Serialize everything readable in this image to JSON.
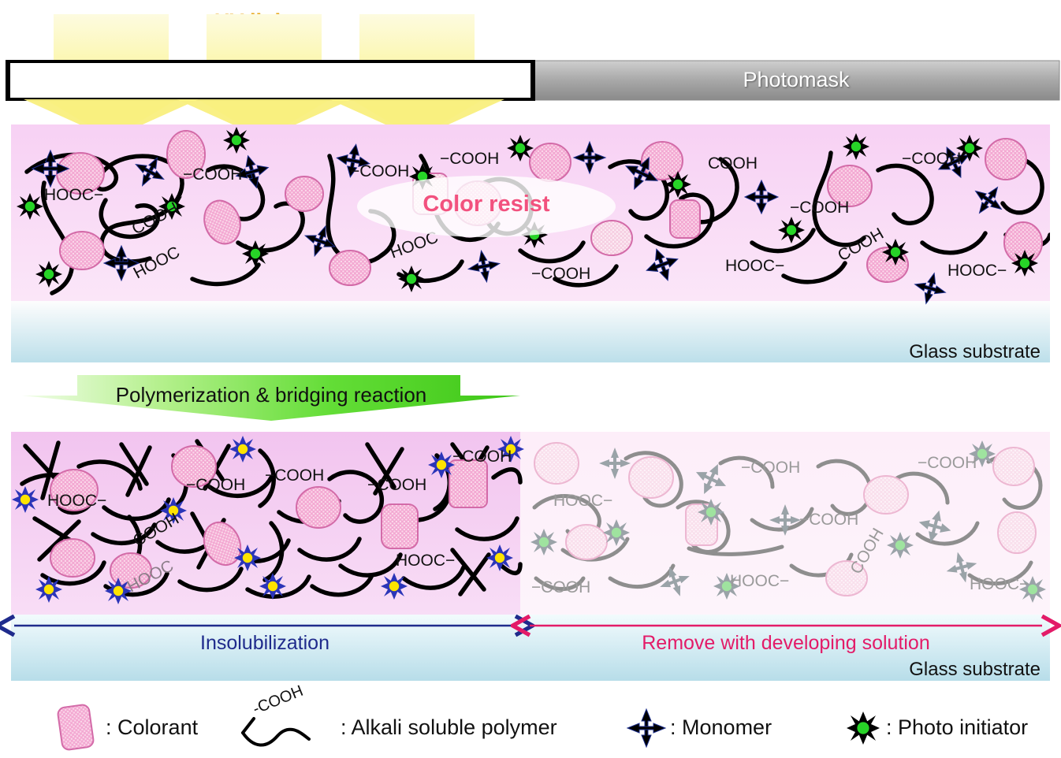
{
  "figure": {
    "type": "process-diagram",
    "subject": "Photolithographic patterning of color resist on glass substrate"
  },
  "uv": {
    "label": "UV light",
    "color": "#e8a81c",
    "beam_color": "#fbf7a8",
    "beam_count": 3
  },
  "photomask": {
    "label": "Photomask",
    "fill_start": "#c9c9c9",
    "fill_end": "#8d8d8d",
    "text_color": "#ffffff",
    "window_label": "",
    "window_border": "#000000"
  },
  "resist_top": {
    "label": "Color resist",
    "label_color": "#f2517e",
    "fill": "#f7d5f2"
  },
  "substrate": {
    "label": "Glass substrate",
    "fill_top": "#ffffff",
    "fill_bottom": "#bfe0ea",
    "text_color": "#1a1a1a"
  },
  "reaction_arrow": {
    "label": "Polymerization & bridging reaction",
    "fill_start": "#d9f7c0",
    "fill_end": "#49d котор",
    "color_a": "#dcf8c4",
    "color_b": "#53d42a",
    "text_color": "#111111"
  },
  "exposed_region": {
    "name": "cured-crosslinked-region",
    "fill": "#f3c8ef",
    "initiator_star": "#2b35b8",
    "initiator_core": "#ffe400",
    "chain_color": "#000000"
  },
  "unexposed_region": {
    "name": "washed-away-region",
    "fill": "#fdeef9",
    "initiator_star": "#9aa3a8",
    "initiator_core": "#9fe39f",
    "chain_color": "#8e8e8e"
  },
  "bottom_arrows": [
    {
      "label": "Insolubilization",
      "color": "#1f2b8c"
    },
    {
      "label": "Remove with developing solution",
      "color": "#e31b68"
    }
  ],
  "legend": {
    "items": [
      {
        "icon": "colorant-swatch-icon",
        "separator": ":",
        "label": "Colorant"
      },
      {
        "icon": "polymer-chain-icon",
        "icon_text": "-COOH",
        "separator": ":",
        "label": "Alkali soluble polymer"
      },
      {
        "icon": "monomer-cross-icon",
        "separator": ":",
        "label": "Monomer"
      },
      {
        "icon": "photo-initiator-star-icon",
        "separator": ":",
        "label": "Photo initiator"
      }
    ]
  },
  "chem_labels": {
    "cooh": "COOH",
    "hooc": "HOOC",
    "dash_cooh": "−COOH",
    "hooc_dash": "HOOC−"
  }
}
